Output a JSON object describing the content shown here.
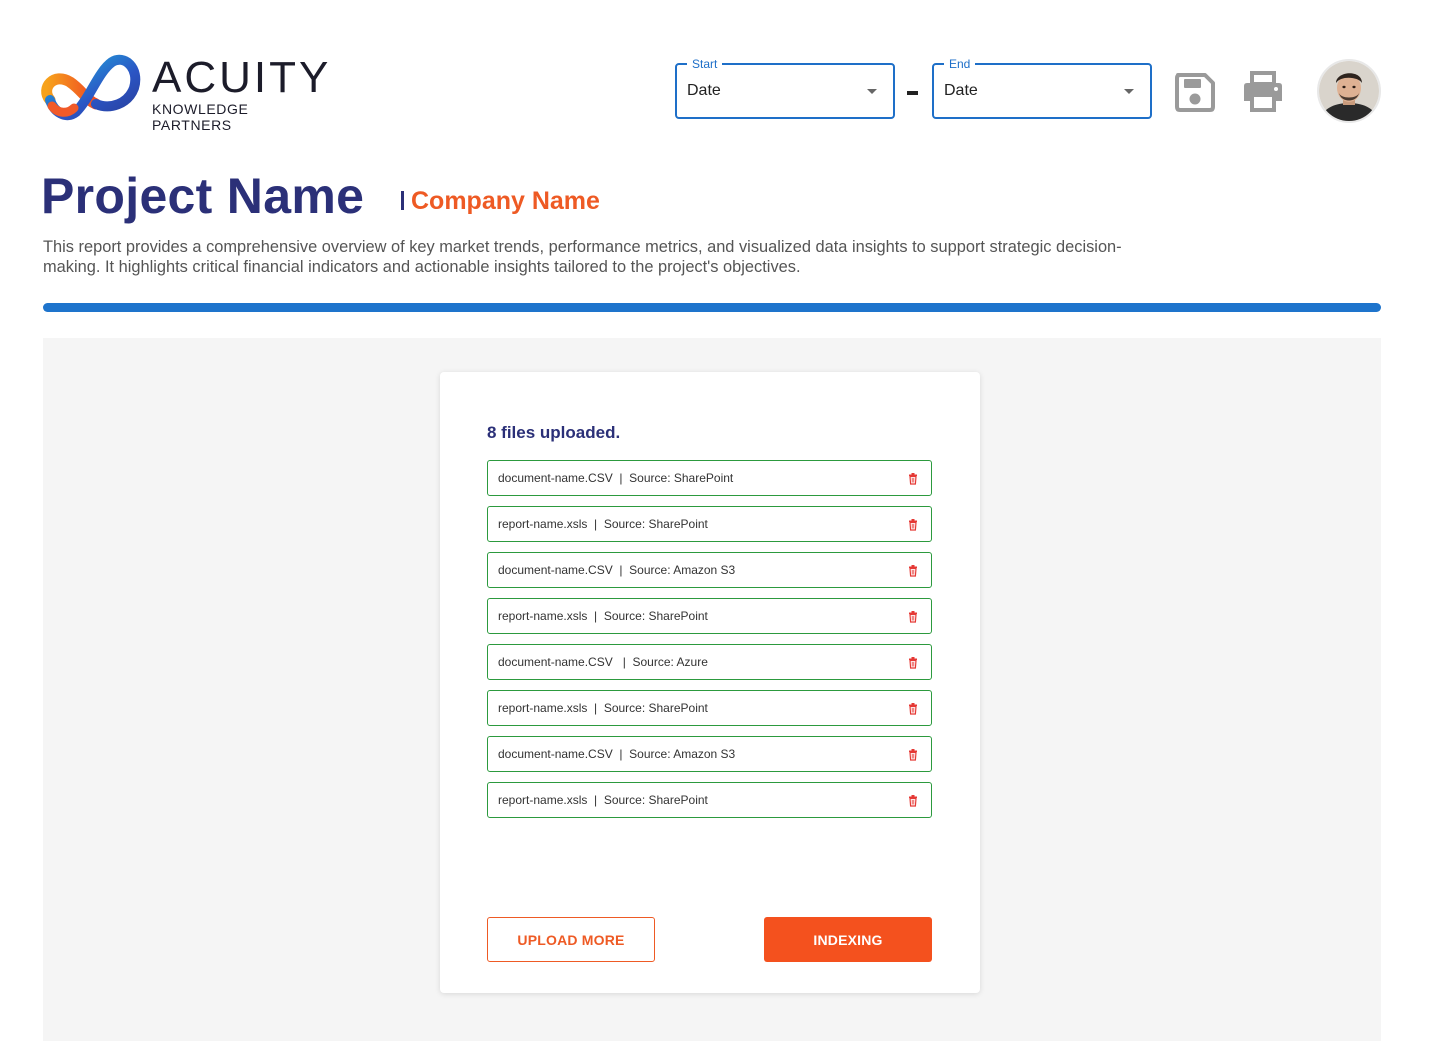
{
  "brand": {
    "name": "ACUITY",
    "tagline": "KNOWLEDGE PARTNERS"
  },
  "date_range": {
    "start": {
      "legend": "Start",
      "value": "Date"
    },
    "end": {
      "legend": "End",
      "value": "Date"
    }
  },
  "toolbar": {
    "save_icon": "save-icon",
    "print_icon": "print-icon"
  },
  "header": {
    "title": "Project Name",
    "company": "Company Name",
    "description": "This report provides a comprehensive overview of key market trends, performance metrics, and visualized data insights to support strategic decision-making. It highlights critical financial indicators and actionable insights tailored to the project's objectives."
  },
  "upload": {
    "status": "8 files uploaded.",
    "files": [
      {
        "label": "document-name.CSV  |  Source: SharePoint"
      },
      {
        "label": "report-name.xsls  |  Source: SharePoint"
      },
      {
        "label": "document-name.CSV  |  Source: Amazon S3"
      },
      {
        "label": "report-name.xsls  |  Source: SharePoint"
      },
      {
        "label": "document-name.CSV   |  Source: Azure"
      },
      {
        "label": "report-name.xsls  |  Source: SharePoint"
      },
      {
        "label": "document-name.CSV  |  Source: Amazon S3"
      },
      {
        "label": "report-name.xsls  |  Source: SharePoint"
      }
    ],
    "upload_more_label": "UPLOAD MORE",
    "indexing_label": "INDEXING"
  },
  "colors": {
    "brand_navy": "#2b3078",
    "accent_orange": "#ee5a24",
    "primary_blue": "#1e74cc",
    "file_border_green": "#2c9a3e",
    "trash_red": "#e53935"
  }
}
